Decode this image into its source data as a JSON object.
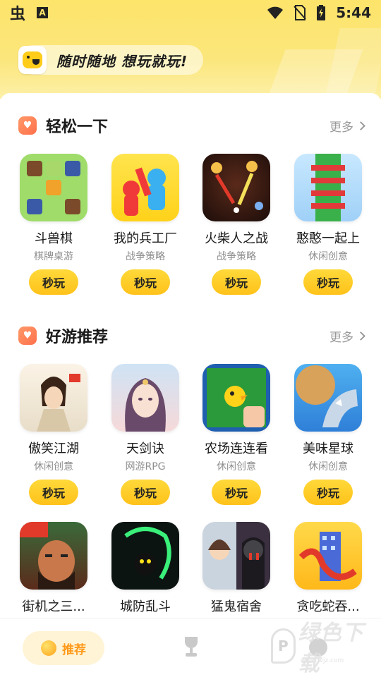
{
  "status_bar": {
    "app_icon": "虫",
    "notif_badge": "A",
    "time": "5:44"
  },
  "header": {
    "slogan": "随时随地 想玩就玩!"
  },
  "sections": [
    {
      "title": "轻松一下",
      "more_label": "更多",
      "games": [
        {
          "name": "斗兽棋",
          "category": "棋牌桌游",
          "button": "秒玩"
        },
        {
          "name": "我的兵工厂",
          "category": "战争策略",
          "button": "秒玩"
        },
        {
          "name": "火柴人之战",
          "category": "战争策略",
          "button": "秒玩"
        },
        {
          "name": "憨憨一起上",
          "category": "休闲创意",
          "button": "秒玩"
        }
      ]
    },
    {
      "title": "好游推荐",
      "more_label": "更多",
      "games": [
        {
          "name": "傲笑江湖",
          "category": "休闲创意",
          "button": "秒玩"
        },
        {
          "name": "天剑诀",
          "category": "网游RPG",
          "button": "秒玩"
        },
        {
          "name": "农场连连看",
          "category": "休闲创意",
          "button": "秒玩"
        },
        {
          "name": "美味星球",
          "category": "休闲创意",
          "button": "秒玩"
        },
        {
          "name": "街机之三...",
          "category": "",
          "button": ""
        },
        {
          "name": "城防乱斗",
          "category": "",
          "button": ""
        },
        {
          "name": "猛鬼宿舍",
          "category": "",
          "button": ""
        },
        {
          "name": "贪吃蛇吞...",
          "category": "",
          "button": ""
        }
      ]
    }
  ],
  "bottom_nav": {
    "recommend_label": "推荐"
  },
  "watermark": {
    "text": "绿色下载",
    "url": "www.lvjz.com"
  },
  "colors": {
    "accent_yellow": "#ffc21a",
    "header_yellow": "#fde46a",
    "nav_active": "#ff9a1a",
    "section_icon": "#ff7a52"
  }
}
